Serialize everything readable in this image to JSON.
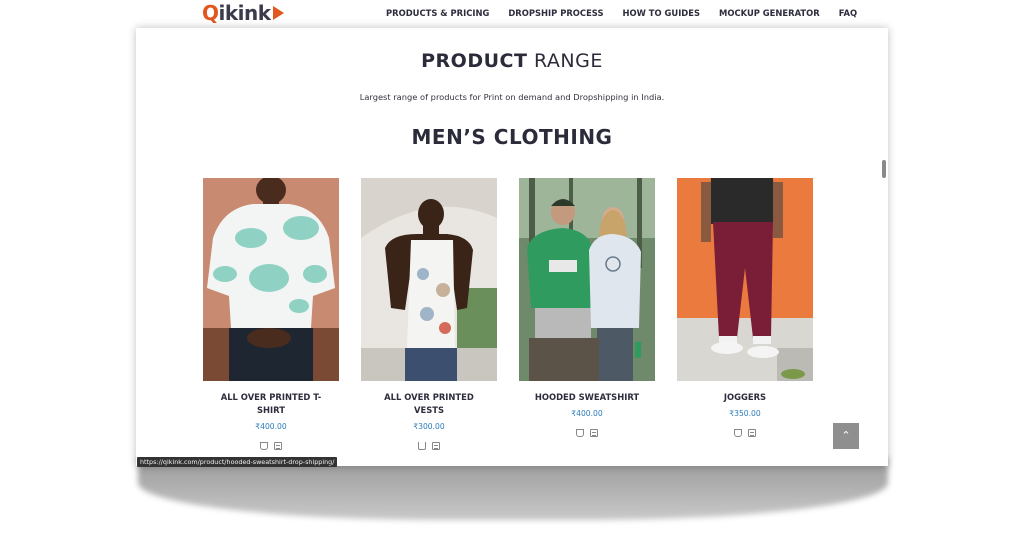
{
  "logo": {
    "letter": "Q",
    "rest": "ikink"
  },
  "nav": [
    {
      "label": "PRODUCTS & PRICING"
    },
    {
      "label": "DROPSHIP PROCESS"
    },
    {
      "label": "HOW TO GUIDES"
    },
    {
      "label": "MOCKUP GENERATOR"
    },
    {
      "label": "FAQ"
    }
  ],
  "section": {
    "title_bold": "PRODUCT",
    "title_thin": "RANGE",
    "subtitle": "Largest range of products for Print on demand and Dropshipping in India.",
    "category": "MEN’S CLOTHING"
  },
  "products": [
    {
      "name": "ALL OVER PRINTED T-SHIRT",
      "price": "₹400.00"
    },
    {
      "name": "ALL OVER PRINTED VESTS",
      "price": "₹300.00"
    },
    {
      "name": "HOODED SWEATSHIRT",
      "price": "₹400.00"
    },
    {
      "name": "JOGGERS",
      "price": "₹350.00"
    }
  ],
  "icons": {
    "back_to_top": "chevron-up-icon",
    "cart": "cart-icon",
    "details": "list-icon"
  },
  "status_url": "https://qikink.com/product/hooded-sweatshirt-drop-shipping/",
  "colors": {
    "brand_orange": "#e2571f",
    "price_blue": "#2b7bb9",
    "text_dark": "#2b2b3a"
  }
}
